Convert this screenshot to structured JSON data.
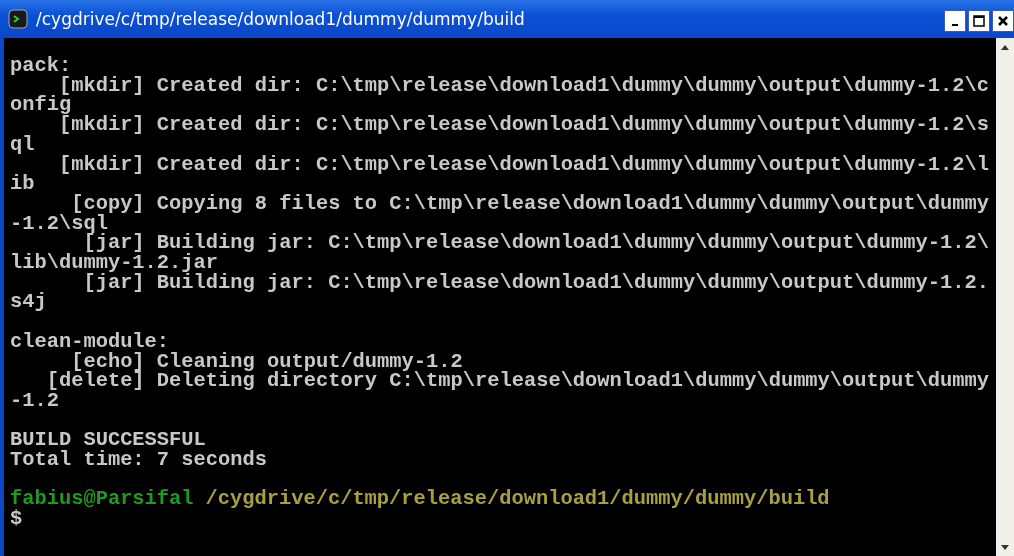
{
  "window": {
    "title": "/cygdrive/c/tmp/release/download1/dummy/dummy/build"
  },
  "blocks": [
    {
      "lines": [
        "pack:",
        "    [mkdir] Created dir: C:\\tmp\\release\\download1\\dummy\\dummy\\output\\dummy-1.2\\c",
        "onfig",
        "    [mkdir] Created dir: C:\\tmp\\release\\download1\\dummy\\dummy\\output\\dummy-1.2\\s",
        "ql",
        "    [mkdir] Created dir: C:\\tmp\\release\\download1\\dummy\\dummy\\output\\dummy-1.2\\l",
        "ib",
        "     [copy] Copying 8 files to C:\\tmp\\release\\download1\\dummy\\dummy\\output\\dummy",
        "-1.2\\sql",
        "      [jar] Building jar: C:\\tmp\\release\\download1\\dummy\\dummy\\output\\dummy-1.2\\",
        "lib\\dummy-1.2.jar",
        "      [jar] Building jar: C:\\tmp\\release\\download1\\dummy\\dummy\\output\\dummy-1.2.",
        "s4j"
      ]
    },
    {
      "lines": [
        "clean-module:",
        "     [echo] Cleaning output/dummy-1.2",
        "   [delete] Deleting directory C:\\tmp\\release\\download1\\dummy\\dummy\\output\\dummy",
        "-1.2"
      ]
    },
    {
      "lines": [
        "BUILD SUCCESSFUL",
        "Total time: 7 seconds"
      ]
    }
  ],
  "prompt": {
    "user": "fabius@Parsifal",
    "path": "/cygdrive/c/tmp/release/download1/dummy/dummy/build",
    "symbol": "$"
  }
}
